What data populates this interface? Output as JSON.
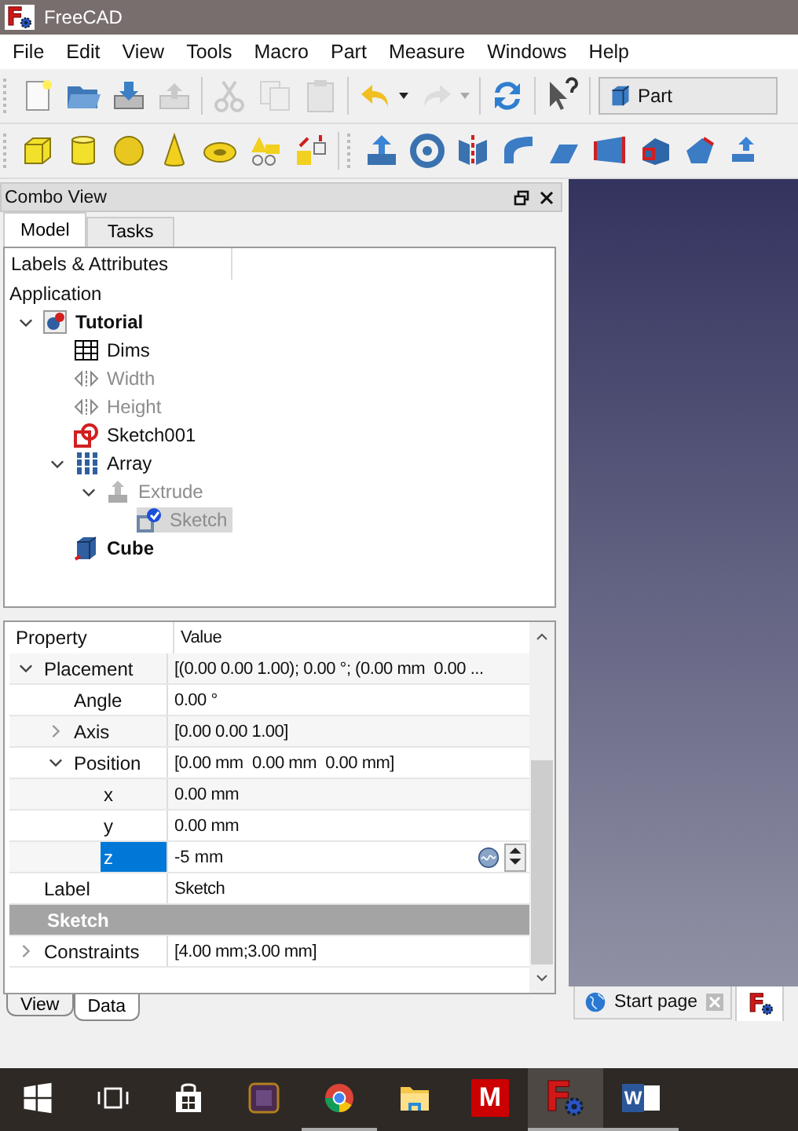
{
  "window": {
    "title": "FreeCAD",
    "logo_glyph": "F"
  },
  "menu": [
    "File",
    "Edit",
    "View",
    "Tools",
    "Macro",
    "Part",
    "Measure",
    "Windows",
    "Help"
  ],
  "toolbar": {
    "buttons": [
      {
        "disabled": false
      },
      {
        "disabled": false
      },
      {
        "disabled": false
      },
      {
        "disabled": true
      },
      {
        "disabled": true
      },
      {
        "disabled": true
      },
      {
        "disabled": true
      },
      {
        "disabled": false
      },
      {
        "disabled": true
      },
      {
        "disabled": false
      },
      {
        "disabled": false
      }
    ],
    "workbench": "Part"
  },
  "combo_view": {
    "title": "Combo View",
    "tabs": [
      {
        "label": "Model",
        "selected": true
      },
      {
        "label": "Tasks",
        "selected": false
      }
    ]
  },
  "tree": {
    "header": "Labels & Attributes",
    "root": "Application",
    "items": [
      {
        "label": "Tutorial",
        "kind": "document",
        "bold": true,
        "hidden": false,
        "selected": false,
        "expanded": true,
        "children": [
          {
            "label": "Dims",
            "kind": "spreadsheet",
            "bold": false,
            "hidden": false,
            "selected": false
          },
          {
            "label": "Width",
            "kind": "constraint",
            "bold": false,
            "hidden": true,
            "selected": false
          },
          {
            "label": "Height",
            "kind": "constraint",
            "bold": false,
            "hidden": true,
            "selected": false
          },
          {
            "label": "Sketch001",
            "kind": "sketch",
            "bold": false,
            "hidden": false,
            "selected": false
          },
          {
            "label": "Array",
            "kind": "array",
            "bold": false,
            "hidden": false,
            "selected": false,
            "expanded": true,
            "children": [
              {
                "label": "Extrude",
                "kind": "extrude",
                "bold": false,
                "hidden": true,
                "selected": false,
                "expanded": true,
                "children": [
                  {
                    "label": "Sketch",
                    "kind": "attached-sketch",
                    "bold": false,
                    "hidden": true,
                    "selected": true
                  }
                ]
              }
            ]
          },
          {
            "label": "Cube",
            "kind": "cube",
            "bold": true,
            "hidden": false,
            "selected": false
          }
        ]
      }
    ]
  },
  "properties": {
    "columns": [
      "Property",
      "Value"
    ],
    "rows": [
      {
        "kind": "property",
        "name": "Placement",
        "value": "[(0.00 0.00 1.00); 0.00 °; (0.00 mm  0.00 ...",
        "selected": false,
        "editing": false,
        "expanded": true,
        "children": [
          {
            "kind": "property",
            "name": "Angle",
            "value": "0.00 °",
            "selected": false,
            "editing": false
          },
          {
            "kind": "property",
            "name": "Axis",
            "value": "[0.00 0.00 1.00]",
            "selected": false,
            "editing": false,
            "expanded": false
          },
          {
            "kind": "property",
            "name": "Position",
            "value": "[0.00 mm  0.00 mm  0.00 mm]",
            "selected": false,
            "editing": false,
            "expanded": true,
            "children": [
              {
                "kind": "property",
                "name": "x",
                "value": "0.00 mm",
                "selected": false,
                "editing": false
              },
              {
                "kind": "property",
                "name": "y",
                "value": "0.00 mm",
                "selected": false,
                "editing": false
              },
              {
                "kind": "property",
                "name": "z",
                "value": "-5 mm",
                "selected": true,
                "editing": true
              }
            ]
          }
        ]
      },
      {
        "kind": "property",
        "name": "Label",
        "value": "Sketch",
        "selected": false,
        "editing": false
      },
      {
        "kind": "group",
        "name": "Sketch"
      },
      {
        "kind": "property",
        "name": "Constraints",
        "value": "[4.00 mm;3.00 mm]",
        "selected": false,
        "editing": false,
        "expanded": false
      }
    ],
    "tabs": [
      {
        "label": "View",
        "selected": false
      },
      {
        "label": "Data",
        "selected": true
      }
    ]
  },
  "view_tabs": [
    {
      "label": "Start page",
      "kind": "web",
      "selected": false,
      "closable": true
    },
    {
      "kind": "document",
      "glyph": "F",
      "selected": true,
      "closable": false
    }
  ],
  "taskbar": [
    {
      "kind": "start",
      "running": false,
      "active": false
    },
    {
      "kind": "task-view",
      "running": false,
      "active": false
    },
    {
      "kind": "store",
      "running": false,
      "active": false
    },
    {
      "kind": "app",
      "running": false,
      "active": false
    },
    {
      "kind": "chrome",
      "running": true,
      "active": false
    },
    {
      "kind": "explorer",
      "running": false,
      "active": false
    },
    {
      "kind": "letter-app",
      "glyph": "M",
      "running": false,
      "active": false
    },
    {
      "kind": "freecad",
      "glyph": "F",
      "running": true,
      "active": true
    },
    {
      "kind": "word",
      "glyph": "W",
      "running": true,
      "active": false
    }
  ]
}
